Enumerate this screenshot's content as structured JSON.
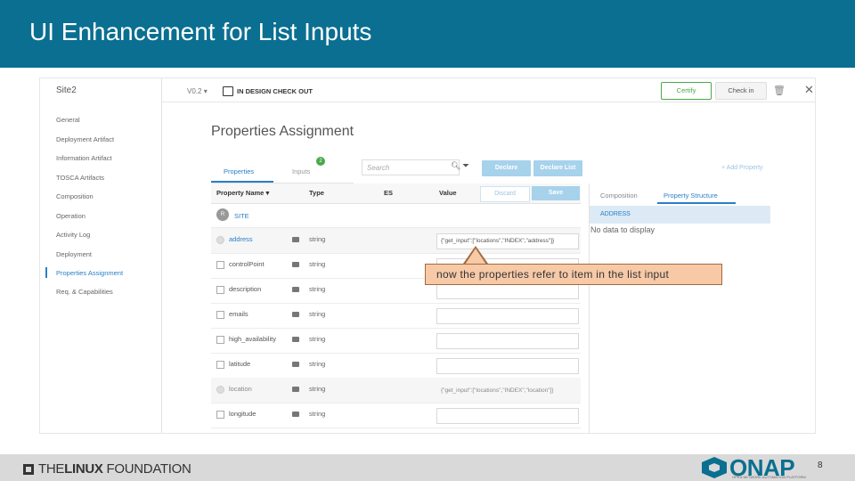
{
  "slide": {
    "title": "UI Enhancement for List Inputs",
    "page_number": "8"
  },
  "app": {
    "service_name": "Site2",
    "version": "V0.2",
    "status": "IN DESIGN CHECK OUT",
    "certify_label": "Certify",
    "checkin_label": "Check in",
    "sidebar": [
      {
        "label": "General"
      },
      {
        "label": "Deployment Artifact"
      },
      {
        "label": "Information Artifact"
      },
      {
        "label": "TOSCA Artifacts"
      },
      {
        "label": "Composition"
      },
      {
        "label": "Operation"
      },
      {
        "label": "Activity Log"
      },
      {
        "label": "Deployment"
      },
      {
        "label": "Properties Assignment",
        "active": true
      },
      {
        "label": "Req. & Capabilities"
      }
    ],
    "page_title": "Properties Assignment",
    "tabs": {
      "properties": "Properties",
      "inputs": "Inputs",
      "inputs_badge": "2"
    },
    "search_placeholder": "Search",
    "declare_label": "Declare",
    "declare_list_label": "Declare List",
    "add_property_label": "Add Property",
    "table": {
      "headers": {
        "name": "Property Name",
        "type": "Type",
        "es": "ES",
        "value": "Value"
      },
      "discard_label": "Discard",
      "save_label": "Save",
      "group": {
        "badge": "R",
        "label": "SITE"
      },
      "rows": [
        {
          "name": "address",
          "type": "string",
          "value": "{\"get_input\":[\"locations\",\"INDEX\",\"address\"]}",
          "disabled": true
        },
        {
          "name": "controlPoint",
          "type": "string",
          "value": ""
        },
        {
          "name": "description",
          "type": "string",
          "value": ""
        },
        {
          "name": "emails",
          "type": "string",
          "value": ""
        },
        {
          "name": "high_availability",
          "type": "string",
          "value": ""
        },
        {
          "name": "latitude",
          "type": "string",
          "value": ""
        },
        {
          "name": "location",
          "type": "string",
          "value": "{\"get_input\":[\"locations\",\"INDEX\",\"location\"]}",
          "disabled": true
        },
        {
          "name": "longitude",
          "type": "string",
          "value": ""
        }
      ]
    },
    "right_panel": {
      "tab_composition": "Composition",
      "tab_structure": "Property Structure",
      "header": "ADDRESS",
      "empty": "No data to display"
    }
  },
  "callout": "now the properties refer to item in the list input",
  "footer": {
    "linux_foundation_a": "THE",
    "linux_foundation_b": "LINUX",
    "linux_foundation_c": " FOUNDATION",
    "onap": "ONAP",
    "onap_sub": "OPEN NETWORK AUTOMATION PLATFORM"
  },
  "colors": {
    "title_bar": "#0a6f91",
    "accent_blue": "#2a7fc6",
    "callout_fill": "#f7c9a7",
    "certify_green": "#4aa84a"
  }
}
